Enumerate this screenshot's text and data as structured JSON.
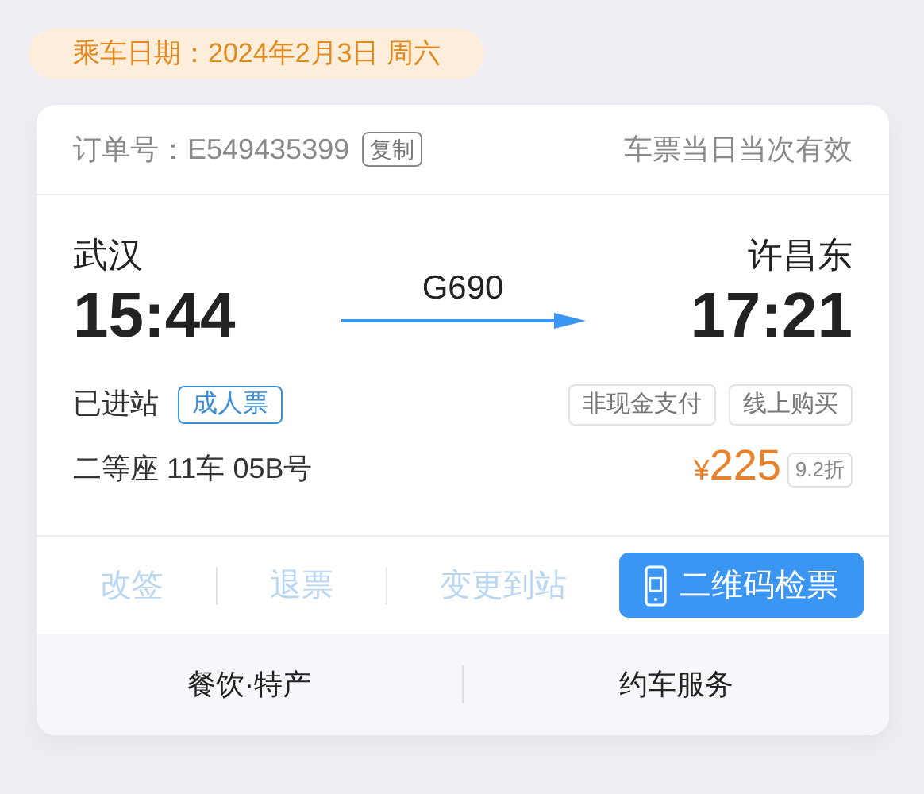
{
  "travel_date": "乘车日期：2024年2月3日 周六",
  "order": {
    "label": "订单号：E549435399",
    "copy_button": "复制",
    "validity": "车票当日当次有效"
  },
  "trip": {
    "from_station": "武汉",
    "departure_time": "15:44",
    "train": "G690",
    "to_station": "许昌东",
    "arrival_time": "17:21"
  },
  "status": "已进站",
  "ticket_type": "成人票",
  "tags": [
    "非现金支付",
    "线上购买"
  ],
  "seat": "二等座 11车 05B号",
  "price": {
    "currency": "¥",
    "amount": "225",
    "discount": "9.2折"
  },
  "actions": [
    {
      "kind": "link",
      "label": "改签",
      "disabled": true
    },
    {
      "kind": "link",
      "label": "退票",
      "disabled": true
    },
    {
      "kind": "link",
      "label": "变更到站",
      "disabled": true
    },
    {
      "kind": "primary",
      "label": "二维码检票",
      "disabled": false
    }
  ],
  "services": [
    "餐饮·特产",
    "约车服务"
  ]
}
